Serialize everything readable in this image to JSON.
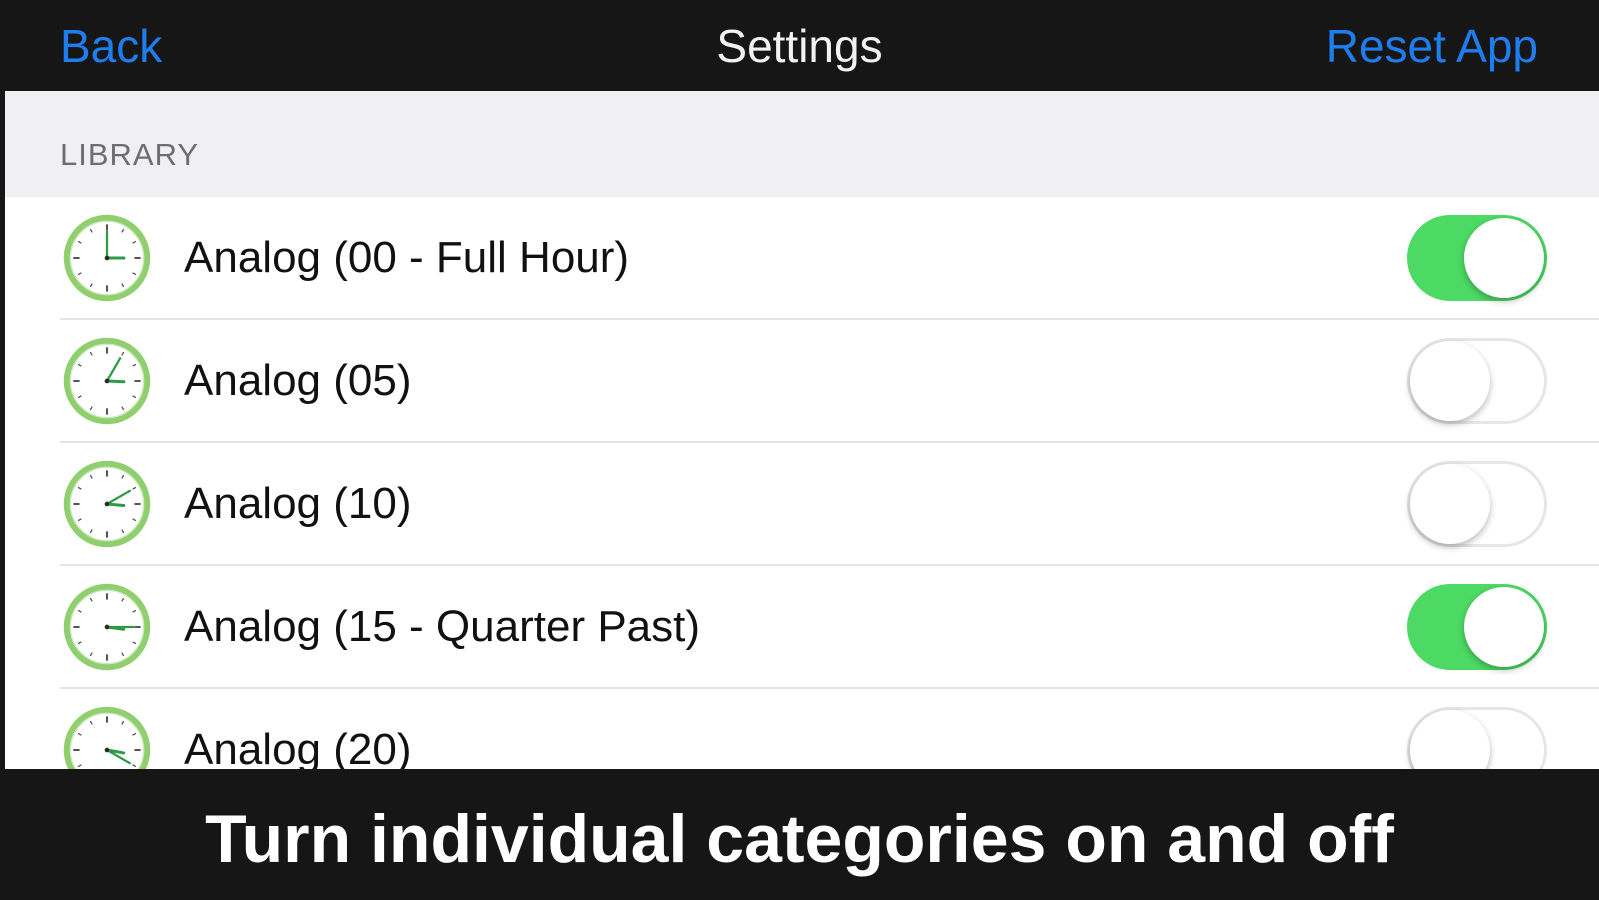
{
  "navbar": {
    "back_label": "Back",
    "title": "Settings",
    "reset_label": "Reset App",
    "link_color": "#1e7ef0"
  },
  "library": {
    "section_title": "LIBRARY",
    "items": [
      {
        "label": "Analog (00 - Full Hour)",
        "enabled": true,
        "icon": "clock-icon"
      },
      {
        "label": "Analog (05)",
        "enabled": false,
        "icon": "clock-icon"
      },
      {
        "label": "Analog (10)",
        "enabled": false,
        "icon": "clock-icon"
      },
      {
        "label": "Analog (15 - Quarter Past)",
        "enabled": true,
        "icon": "clock-icon"
      },
      {
        "label": "Analog (20)",
        "enabled": false,
        "icon": "clock-icon"
      }
    ]
  },
  "caption": {
    "text": "Turn individual categories on and off"
  },
  "colors": {
    "toggle_on": "#4cd964",
    "toggle_off": "#ffffff",
    "clock_rim": "#8fcf6e",
    "clock_hands": "#2f9a46"
  }
}
